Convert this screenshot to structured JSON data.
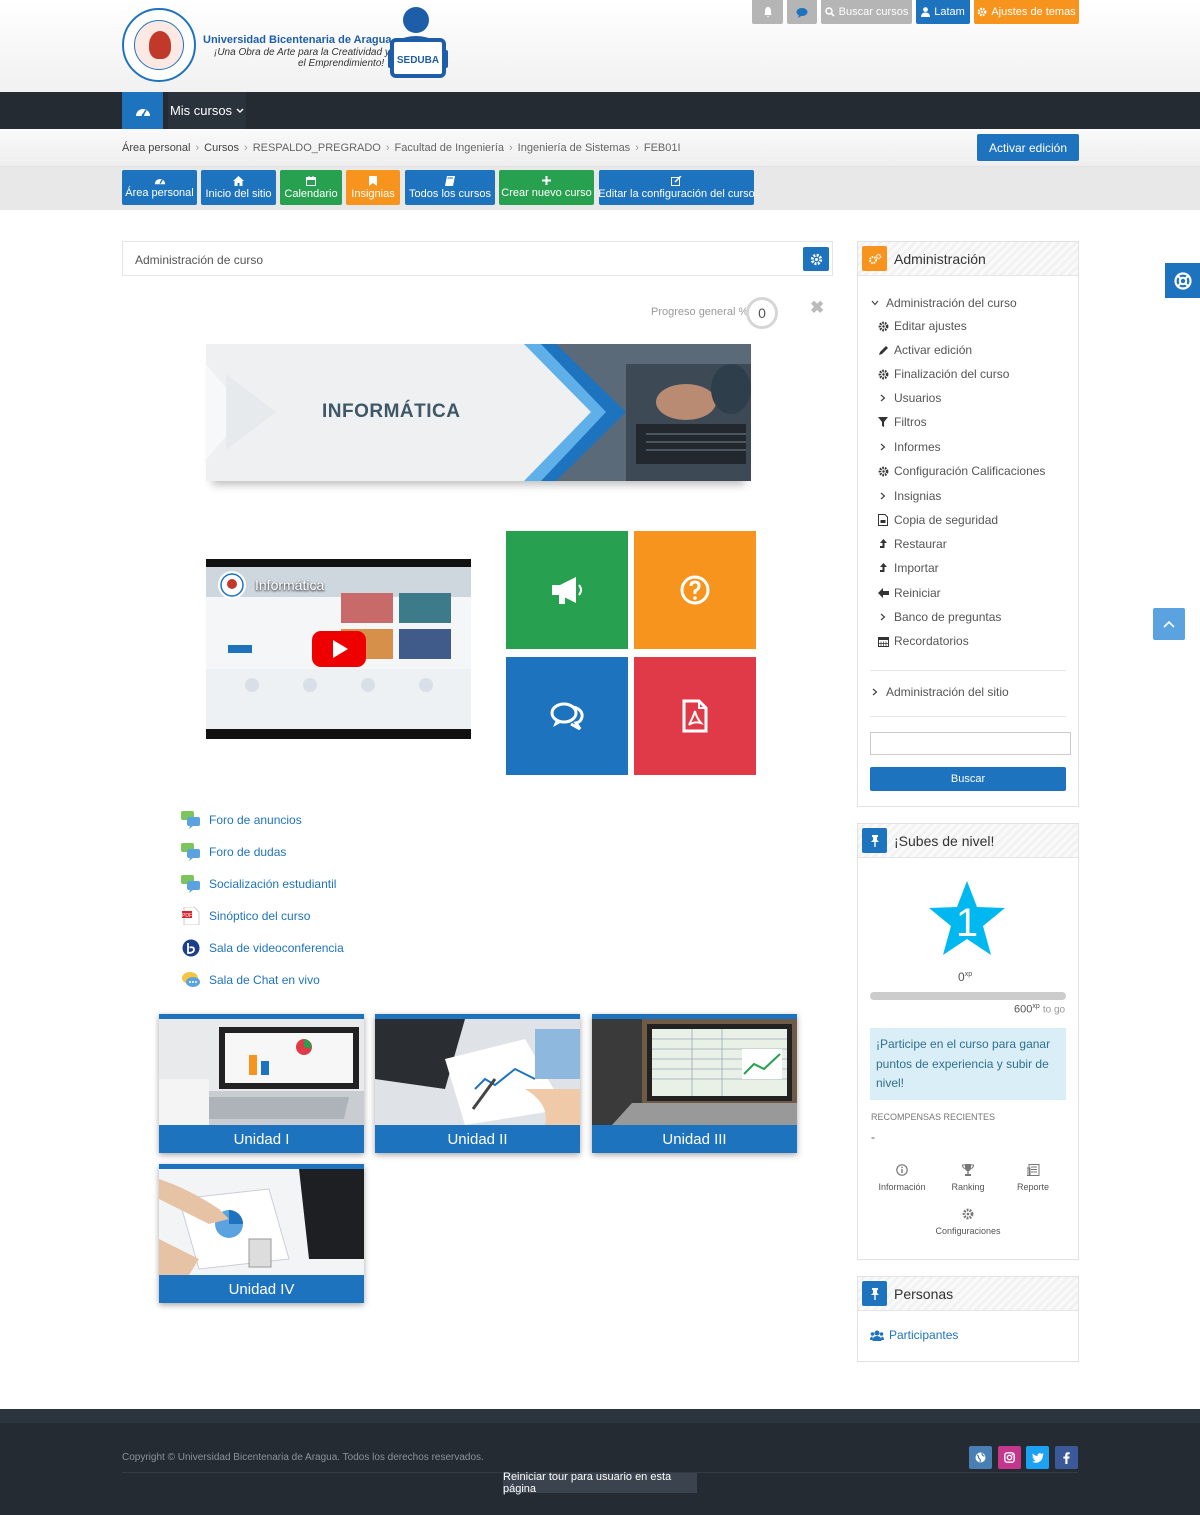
{
  "header": {
    "brand_name": "Universidad Bicentenaria de Aragua",
    "brand_tagline_1": "¡Una Obra de Arte para la Creatividad y",
    "brand_tagline_2": "el Emprendimiento!",
    "seduba_label": "SEDUBA",
    "top_buttons": {
      "search_label": "Buscar cursos",
      "user_label": "Latam",
      "theme_label": "Ajustes de temas"
    }
  },
  "nav": {
    "mis_cursos_label": "Mis cursos"
  },
  "breadcrumb": [
    "Área personal",
    "Cursos",
    "RESPALDO_PREGRADO",
    "Facultad de Ingeniería",
    "Ingeniería de Sistemas",
    "FEB01I"
  ],
  "edit_button_label": "Activar edición",
  "quick_buttons": [
    {
      "label": "Área personal",
      "color": "#1e73be",
      "icon": "dashboard-icon"
    },
    {
      "label": "Inicio del sitio",
      "color": "#1e73be",
      "icon": "home-icon"
    },
    {
      "label": "Calendario",
      "color": "#27a14f",
      "icon": "calendar-icon"
    },
    {
      "label": "Insignias",
      "color": "#f7941e",
      "icon": "bookmark-icon"
    },
    {
      "label": "Todos los cursos",
      "color": "#1e73be",
      "icon": "book-icon"
    },
    {
      "label": "Crear nuevo curso",
      "color": "#27a14f",
      "icon": "plus-icon"
    },
    {
      "label": "Editar la configuración del curso",
      "color": "#1e73be",
      "icon": "edit-icon"
    }
  ],
  "main": {
    "admin_bar_title": "Administración de curso",
    "progress_label": "Progreso general %",
    "progress_value": "0",
    "banner_title": "INFORMÁTICA",
    "video_title": "Informática",
    "tiles": [
      {
        "icon": "megaphone-icon",
        "color": "#27a14f"
      },
      {
        "icon": "question-icon",
        "color": "#f7941e"
      },
      {
        "icon": "chat-icon",
        "color": "#1e73be"
      },
      {
        "icon": "pdf-icon",
        "color": "#e03a48"
      }
    ],
    "activities": [
      {
        "label": "Foro de anuncios",
        "icon": "forum-icon"
      },
      {
        "label": "Foro de dudas",
        "icon": "forum-icon"
      },
      {
        "label": "Socialización estudiantil",
        "icon": "forum-icon"
      },
      {
        "label": "Sinóptico del curso",
        "icon": "pdf-file-icon"
      },
      {
        "label": "Sala de videoconferencia",
        "icon": "bigbluebutton-icon"
      },
      {
        "label": "Sala de Chat en vivo",
        "icon": "chat-bubble-icon"
      }
    ],
    "units": [
      "Unidad I",
      "Unidad II",
      "Unidad III",
      "Unidad IV"
    ]
  },
  "sidebar": {
    "admin_title": "Administración",
    "admin_items": [
      {
        "label": "Administración del curso",
        "icon": "chevron-down-icon"
      },
      {
        "label": "Editar ajustes",
        "icon": "gear-icon"
      },
      {
        "label": "Activar edición",
        "icon": "pencil-icon"
      },
      {
        "label": "Finalización del curso",
        "icon": "gear-icon"
      },
      {
        "label": "Usuarios",
        "icon": "chevron-right-icon"
      },
      {
        "label": "Filtros",
        "icon": "filter-icon"
      },
      {
        "label": "Informes",
        "icon": "chevron-right-icon"
      },
      {
        "label": "Configuración Calificaciones",
        "icon": "gear-icon"
      },
      {
        "label": "Insignias",
        "icon": "chevron-right-icon"
      },
      {
        "label": "Copia de seguridad",
        "icon": "file-icon"
      },
      {
        "label": "Restaurar",
        "icon": "upload-icon"
      },
      {
        "label": "Importar",
        "icon": "upload-icon"
      },
      {
        "label": "Reiniciar",
        "icon": "arrow-left-icon"
      },
      {
        "label": "Banco de preguntas",
        "icon": "chevron-right-icon"
      },
      {
        "label": "Recordatorios",
        "icon": "calendar-icon"
      }
    ],
    "site_admin_label": "Administración del sitio",
    "search_placeholder": "",
    "search_button": "Buscar",
    "level_title": "¡Subes de nivel!",
    "level_number": "1",
    "xp_current": "0",
    "xp_unit": "xp",
    "xp_togo": "600",
    "xp_togo_suffix": "to go",
    "xp_progress": 0,
    "level_message": "¡Participe en el curso para ganar puntos de experiencia y subir de nivel!",
    "recent_rewards_label": "RECOMPENSAS RECIENTES",
    "recent_rewards_value": "-",
    "level_links": [
      "Información",
      "Ranking",
      "Reporte",
      "Configuraciones"
    ],
    "people_title": "Personas",
    "participants_label": "Participantes"
  },
  "footer": {
    "copyright": "Copyright © Universidad Bicentenaria de Aragua. Todos los derechos reservados.",
    "tour_button": "Reiniciar tour para usuario en esta página",
    "social": [
      {
        "icon": "globe-icon",
        "color": "#4a7fb5"
      },
      {
        "icon": "instagram-icon",
        "color": "#c4378c"
      },
      {
        "icon": "twitter-icon",
        "color": "#1da1f2"
      },
      {
        "icon": "facebook-icon",
        "color": "#3b5998"
      }
    ]
  },
  "colors": {
    "primary": "#1e73be",
    "orange": "#f7941e",
    "green": "#27a14f",
    "red": "#e03a48",
    "dark": "#242b33"
  }
}
